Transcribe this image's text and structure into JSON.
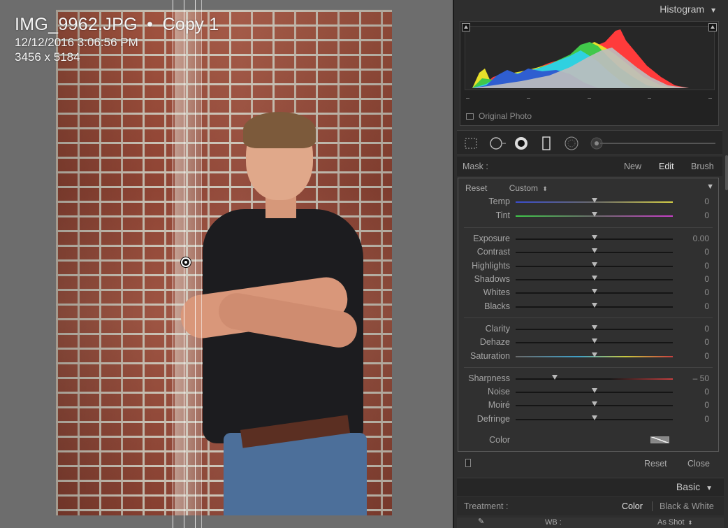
{
  "photo": {
    "filename": "IMG_9962.JPG",
    "separator": "•",
    "copy_label": "Copy 1",
    "datetime": "12/12/2016 3:06:56 PM",
    "dimensions": "3456 x 5184"
  },
  "histogram": {
    "title": "Histogram",
    "original_photo_label": "Original Photo",
    "colors": {
      "red": "#ff3b3b",
      "yellow": "#e8e02a",
      "green": "#41c84a",
      "cyan": "#2fd1e0",
      "blue": "#2f5ed0",
      "gray": "#bdbdbd"
    }
  },
  "tools": [
    "crop-overlay-icon",
    "spot-removal-icon",
    "red-eye-icon",
    "graduated-filter-icon",
    "radial-filter-icon",
    "adjustment-brush-icon"
  ],
  "mask": {
    "label": "Mask :",
    "new": "New",
    "edit": "Edit",
    "brush": "Brush"
  },
  "adjust": {
    "reset": "Reset",
    "preset": "Custom",
    "preset_icon": "up-down-arrows-icon",
    "groups": [
      [
        {
          "name": "Temp",
          "value": "0",
          "pos": 0.5,
          "track": "temp"
        },
        {
          "name": "Tint",
          "value": "0",
          "pos": 0.5,
          "track": "tint"
        }
      ],
      [
        {
          "name": "Exposure",
          "value": "0.00",
          "pos": 0.5
        },
        {
          "name": "Contrast",
          "value": "0",
          "pos": 0.5
        },
        {
          "name": "Highlights",
          "value": "0",
          "pos": 0.5
        },
        {
          "name": "Shadows",
          "value": "0",
          "pos": 0.5
        },
        {
          "name": "Whites",
          "value": "0",
          "pos": 0.5
        },
        {
          "name": "Blacks",
          "value": "0",
          "pos": 0.5
        }
      ],
      [
        {
          "name": "Clarity",
          "value": "0",
          "pos": 0.5
        },
        {
          "name": "Dehaze",
          "value": "0",
          "pos": 0.5
        },
        {
          "name": "Saturation",
          "value": "0",
          "pos": 0.5,
          "track": "sat"
        }
      ],
      [
        {
          "name": "Sharpness",
          "value": "– 50",
          "pos": 0.25,
          "track": "sharp"
        },
        {
          "name": "Noise",
          "value": "0",
          "pos": 0.5
        },
        {
          "name": "Moiré",
          "value": "0",
          "pos": 0.5
        },
        {
          "name": "Defringe",
          "value": "0",
          "pos": 0.5
        }
      ]
    ],
    "color_label": "Color"
  },
  "footer": {
    "reset": "Reset",
    "close": "Close"
  },
  "basic": {
    "title": "Basic",
    "treatment_label": "Treatment :",
    "color": "Color",
    "bw": "Black & White",
    "wb_label": "WB :",
    "wb_value": "As Shot"
  }
}
